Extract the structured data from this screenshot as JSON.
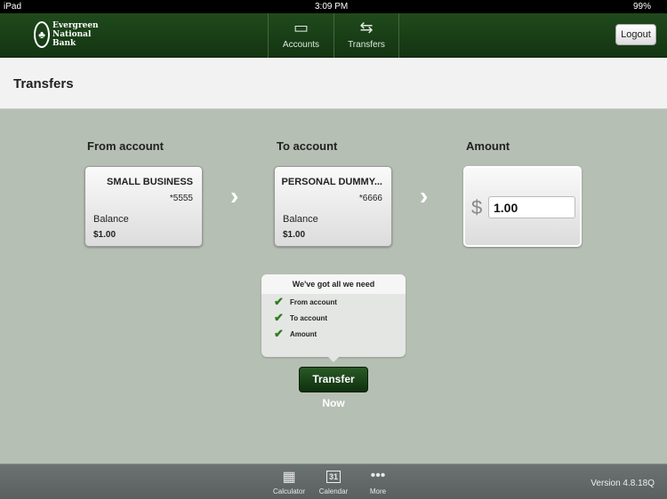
{
  "status": {
    "device": "iPad",
    "time": "3:09 PM",
    "battery": "99%"
  },
  "header": {
    "logo": [
      "Evergreen",
      "National",
      "Bank"
    ],
    "nav": [
      {
        "label": "Accounts"
      },
      {
        "label": "Transfers"
      }
    ],
    "logout": "Logout"
  },
  "page": {
    "title": "Transfers"
  },
  "from": {
    "label": "From account",
    "name": "SMALL BUSINESS",
    "number": "*5555",
    "balance_label": "Balance",
    "balance": "$1.00"
  },
  "to": {
    "label": "To account",
    "name": "PERSONAL DUMMY...",
    "number": "*6666",
    "balance_label": "Balance",
    "balance": "$1.00"
  },
  "amount": {
    "label": "Amount",
    "currency": "$",
    "value": "1.00"
  },
  "checklist": {
    "title": "We've got all we need",
    "items": [
      "From account",
      "To account",
      "Amount"
    ]
  },
  "submit": "Transfer Now",
  "footer": {
    "items": [
      "Calculator",
      "Calendar",
      "More"
    ],
    "calendar_day": "31",
    "version": "Version 4.8.18Q"
  }
}
